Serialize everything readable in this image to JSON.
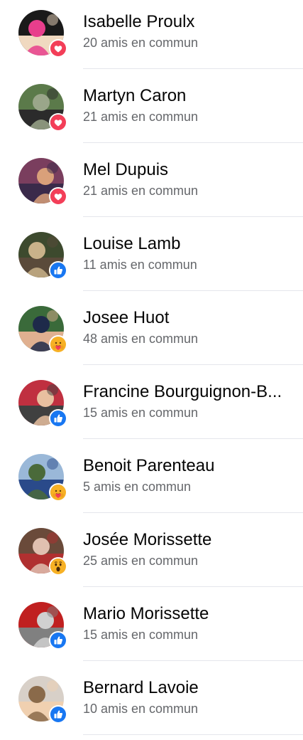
{
  "friends": [
    {
      "name": "Isabelle Proulx",
      "mutual": "20 amis en commun",
      "reaction": "love",
      "avatar_colors": [
        "#1a1a1a",
        "#e83e8c",
        "#f0d9c0"
      ]
    },
    {
      "name": "Martyn Caron",
      "mutual": "21 amis en commun",
      "reaction": "love",
      "avatar_colors": [
        "#5b7a4a",
        "#9aa68a",
        "#2b2b2b"
      ]
    },
    {
      "name": "Mel Dupuis",
      "mutual": "21 amis en commun",
      "reaction": "love",
      "avatar_colors": [
        "#7a3e5e",
        "#d9a07a",
        "#3a2a4a"
      ]
    },
    {
      "name": "Louise Lamb",
      "mutual": "11 amis en commun",
      "reaction": "like",
      "avatar_colors": [
        "#3d4a2e",
        "#c9b28a",
        "#5a4a3a"
      ]
    },
    {
      "name": "Josee Huot",
      "mutual": "48 amis en commun",
      "reaction": "care",
      "avatar_colors": [
        "#3a6a3a",
        "#1e2a4a",
        "#e0b090"
      ]
    },
    {
      "name": "Francine Bourguignon-B...",
      "mutual": "15 amis en commun",
      "reaction": "like",
      "avatar_colors": [
        "#c03040",
        "#e8c0a0",
        "#404040"
      ]
    },
    {
      "name": "Benoit Parenteau",
      "mutual": "5 amis en commun",
      "reaction": "care",
      "avatar_colors": [
        "#9ab8d8",
        "#4a6a3a",
        "#2a4a8a"
      ]
    },
    {
      "name": "Josée Morissette",
      "mutual": "25 amis en commun",
      "reaction": "wow",
      "avatar_colors": [
        "#6a4a3a",
        "#e0c0b0",
        "#b03030"
      ]
    },
    {
      "name": "Mario Morissette",
      "mutual": "15 amis en commun",
      "reaction": "like",
      "avatar_colors": [
        "#c02020",
        "#d0d0d0",
        "#808080"
      ]
    },
    {
      "name": "Bernard Lavoie",
      "mutual": "10 amis en commun",
      "reaction": "like",
      "avatar_colors": [
        "#d8d0c8",
        "#8a6a4a",
        "#f0d0b0"
      ]
    }
  ],
  "colors": {
    "like": "#1877f2",
    "love": "#f33e58",
    "care": "#f7b125",
    "wow": "#f7b125"
  }
}
